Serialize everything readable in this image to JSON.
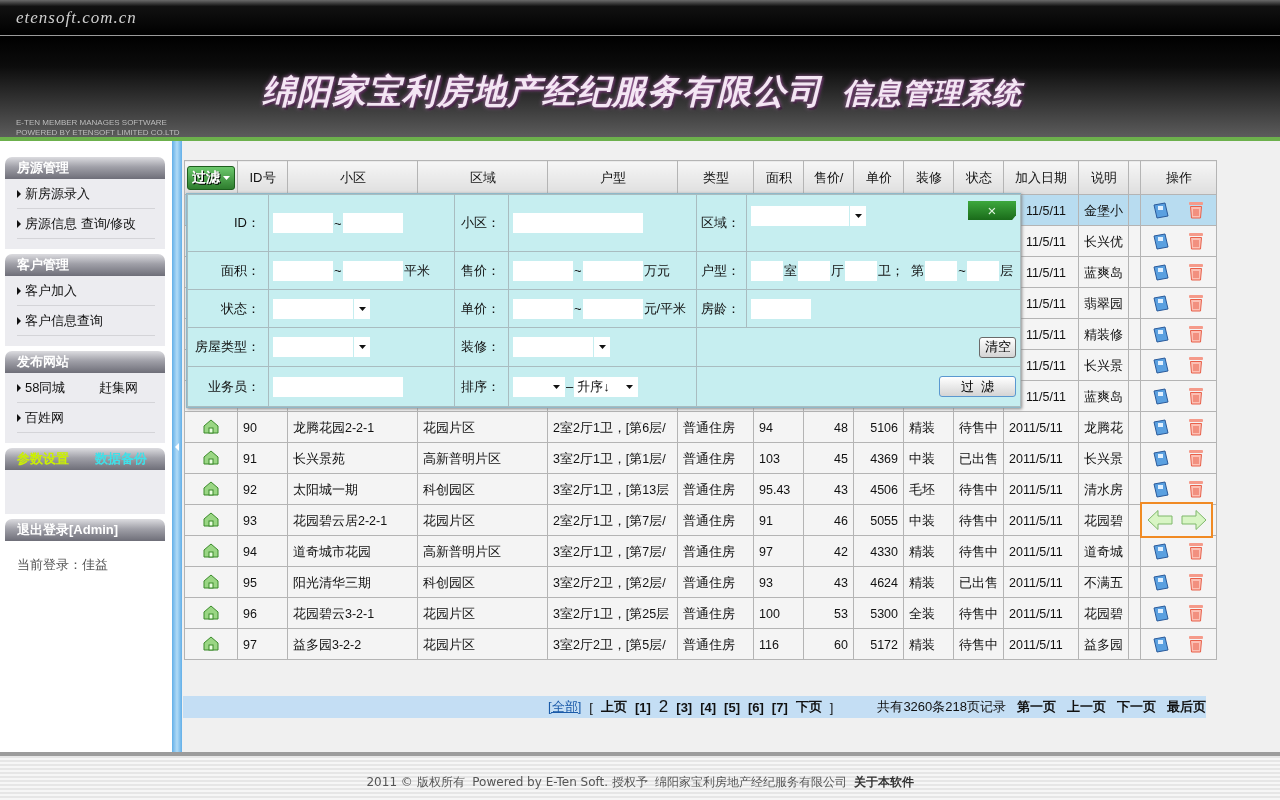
{
  "header": {
    "site": "etensoft.com.cn",
    "title": "绵阳家宝利房地产经纪服务有限公司",
    "subtitle": "信息管理系统",
    "tagline_lines": [
      "E-TEN MEMBER MANAGES SOFTWARE",
      "POWERED BY ETENSOFT LIMITED CO.LTD"
    ]
  },
  "sidebar": {
    "sections": [
      {
        "kind": "menu",
        "title": "房源管理",
        "items": [
          {
            "links": [
              "新房源录入"
            ]
          },
          {
            "links": [
              "房源信息 查询/修改"
            ]
          }
        ]
      },
      {
        "kind": "menu",
        "title": "客户管理",
        "items": [
          {
            "links": [
              "客户加入"
            ]
          },
          {
            "links": [
              "客户信息查询"
            ]
          }
        ]
      },
      {
        "kind": "menu",
        "title": "发布网站",
        "items": [
          {
            "links": [
              "58同城",
              "赶集网"
            ]
          },
          {
            "links": [
              "百姓网"
            ]
          }
        ]
      },
      {
        "kind": "links",
        "links": [
          {
            "text": "参数设置",
            "color": "#ccf000"
          },
          {
            "text": "数据备份",
            "color": "#40e0e8"
          }
        ]
      },
      {
        "kind": "plain",
        "title": "退出登录[Admin]"
      }
    ],
    "current_user": "当前登录：佳益"
  },
  "table": {
    "filter_button": "过滤",
    "columns": [
      "ID号",
      "小区",
      "区域",
      "户型",
      "类型",
      "面积",
      "售价/",
      "单价",
      "装修",
      "状态",
      "加入日期",
      "说明",
      "操作"
    ],
    "rows": [
      {
        "kind": "covered",
        "date": "11/5/11",
        "note": "金堡小",
        "selected": true,
        "hovered": false
      },
      {
        "kind": "covered",
        "date": "11/5/11",
        "note": "长兴优",
        "selected": false,
        "hovered": false
      },
      {
        "kind": "covered",
        "date": "11/5/11",
        "note": "蓝爽岛",
        "selected": false,
        "hovered": false
      },
      {
        "kind": "covered",
        "date": "11/5/11",
        "note": "翡翠园",
        "selected": false,
        "hovered": false
      },
      {
        "kind": "covered",
        "date": "11/5/11",
        "note": "精装修",
        "selected": false,
        "hovered": false
      },
      {
        "kind": "covered",
        "date": "11/5/11",
        "note": "长兴景",
        "selected": false,
        "hovered": false
      },
      {
        "kind": "covered",
        "date": "11/5/11",
        "note": "蓝爽岛",
        "selected": false,
        "hovered": false
      },
      {
        "kind": "full",
        "id": "90",
        "community": "龙腾花园2-2-1",
        "district": "花园片区",
        "layout": "2室2厅1卫，[第6层/",
        "type": "普通住房",
        "area": "94",
        "price": "48",
        "unit_price": "5106",
        "decoration": "精装",
        "status": "待售中",
        "date": "2011/5/11",
        "note": "龙腾花",
        "selected": false,
        "hovered": false
      },
      {
        "kind": "full",
        "id": "91",
        "community": "长兴景苑",
        "district": "高新普明片区",
        "layout": "3室2厅1卫，[第1层/",
        "type": "普通住房",
        "area": "103",
        "price": "45",
        "unit_price": "4369",
        "decoration": "中装",
        "status": "已出售",
        "date": "2011/5/11",
        "note": "长兴景",
        "selected": false,
        "hovered": false
      },
      {
        "kind": "full",
        "id": "92",
        "community": "太阳城一期",
        "district": "科创园区",
        "layout": "3室2厅1卫，[第13层",
        "type": "普通住房",
        "area": "95.43",
        "price": "43",
        "unit_price": "4506",
        "decoration": "毛坯",
        "status": "待售中",
        "date": "2011/5/11",
        "note": "清水房",
        "selected": false,
        "hovered": false
      },
      {
        "kind": "full",
        "id": "93",
        "community": "花园碧云居2-2-1",
        "district": "花园片区",
        "layout": "2室2厅1卫，[第7层/",
        "type": "普通住房",
        "area": "91",
        "price": "46",
        "unit_price": "5055",
        "decoration": "中装",
        "status": "待售中",
        "date": "2011/5/11",
        "note": "花园碧",
        "selected": false,
        "hovered": true
      },
      {
        "kind": "full",
        "id": "94",
        "community": "道奇城市花园",
        "district": "高新普明片区",
        "layout": "3室2厅1卫，[第7层/",
        "type": "普通住房",
        "area": "97",
        "price": "42",
        "unit_price": "4330",
        "decoration": "精装",
        "status": "待售中",
        "date": "2011/5/11",
        "note": "道奇城",
        "selected": false,
        "hovered": false
      },
      {
        "kind": "full",
        "id": "95",
        "community": "阳光清华三期",
        "district": "科创园区",
        "layout": "3室2厅2卫，[第2层/",
        "type": "普通住房",
        "area": "93",
        "price": "43",
        "unit_price": "4624",
        "decoration": "精装",
        "status": "已出售",
        "date": "2011/5/11",
        "note": "不满五",
        "selected": false,
        "hovered": false
      },
      {
        "kind": "full",
        "id": "96",
        "community": "花园碧云3-2-1",
        "district": "花园片区",
        "layout": "3室2厅1卫，[第25层",
        "type": "普通住房",
        "area": "100",
        "price": "53",
        "unit_price": "5300",
        "decoration": "全装",
        "status": "待售中",
        "date": "2011/5/11",
        "note": "花园碧",
        "selected": false,
        "hovered": false
      },
      {
        "kind": "full",
        "id": "97",
        "community": "益多园3-2-2",
        "district": "花园片区",
        "layout": "3室2厅2卫，[第5层/",
        "type": "普通住房",
        "area": "116",
        "price": "60",
        "unit_price": "5172",
        "decoration": "精装",
        "status": "待售中",
        "date": "2011/5/11",
        "note": "益多园",
        "selected": false,
        "hovered": false
      }
    ]
  },
  "filter_panel": {
    "rows": [
      {
        "cells": [
          {
            "label": "ID：",
            "parts": [
              {
                "kind": "input"
              },
              {
                "kind": "text",
                "text": "~"
              },
              {
                "kind": "input"
              }
            ]
          },
          {
            "label": "小区：",
            "parts": [
              {
                "kind": "input-long"
              }
            ]
          },
          {
            "label": "区域：",
            "parts": [
              {
                "kind": "select-long"
              }
            ],
            "button": {
              "kind": "close",
              "text": "×"
            }
          }
        ]
      },
      {
        "cells": [
          {
            "label": "面积：",
            "parts": [
              {
                "kind": "input"
              },
              {
                "kind": "text",
                "text": "~"
              },
              {
                "kind": "input"
              },
              {
                "kind": "text",
                "text": "平米"
              }
            ]
          },
          {
            "label": "售价：",
            "parts": [
              {
                "kind": "input"
              },
              {
                "kind": "text",
                "text": "~"
              },
              {
                "kind": "input"
              },
              {
                "kind": "text",
                "text": "万元"
              }
            ]
          },
          {
            "label": "户型：",
            "parts": [
              {
                "kind": "input-tiny"
              },
              {
                "kind": "text",
                "text": "室"
              },
              {
                "kind": "input-tiny"
              },
              {
                "kind": "text",
                "text": "厅"
              },
              {
                "kind": "input-tiny"
              },
              {
                "kind": "text",
                "text": "卫；  第"
              },
              {
                "kind": "input-tiny"
              },
              {
                "kind": "text",
                "text": "~"
              },
              {
                "kind": "input-tiny"
              },
              {
                "kind": "text",
                "text": "层"
              }
            ]
          }
        ]
      },
      {
        "cells": [
          {
            "label": "状态：",
            "parts": [
              {
                "kind": "select"
              }
            ]
          },
          {
            "label": "单价：",
            "parts": [
              {
                "kind": "input"
              },
              {
                "kind": "text",
                "text": "~"
              },
              {
                "kind": "input"
              },
              {
                "kind": "text",
                "text": "元/平米"
              }
            ]
          },
          {
            "label": "房龄：",
            "parts": [
              {
                "kind": "input"
              }
            ]
          }
        ]
      },
      {
        "cells": [
          {
            "label": "房屋类型：",
            "parts": [
              {
                "kind": "select"
              }
            ]
          },
          {
            "label": "装修：",
            "parts": [
              {
                "kind": "select"
              }
            ]
          },
          {
            "button": {
              "kind": "plain",
              "text": "清空"
            }
          }
        ]
      },
      {
        "cells": [
          {
            "label": "业务员：",
            "parts": [
              {
                "kind": "input-long"
              }
            ]
          },
          {
            "label": "排序：",
            "parts": [
              {
                "kind": "select-short"
              },
              {
                "kind": "text",
                "text": "–"
              },
              {
                "kind": "select-mid",
                "value": "升序↓"
              }
            ]
          },
          {
            "button": {
              "kind": "submit",
              "text": "过  滤"
            }
          }
        ]
      }
    ]
  },
  "pager": {
    "items": [
      {
        "kind": "all",
        "text": "[全部]"
      },
      {
        "kind": "bracket",
        "text": "["
      },
      {
        "kind": "nav",
        "text": "上页"
      },
      {
        "kind": "page",
        "text": "[1]",
        "selected": false
      },
      {
        "kind": "page",
        "text": "2",
        "selected": true
      },
      {
        "kind": "page",
        "text": "[3]",
        "selected": false
      },
      {
        "kind": "page",
        "text": "[4]",
        "selected": false
      },
      {
        "kind": "page",
        "text": "[5]",
        "selected": false
      },
      {
        "kind": "page",
        "text": "[6]",
        "selected": false
      },
      {
        "kind": "page",
        "text": "[7]",
        "selected": false
      },
      {
        "kind": "nav",
        "text": "下页"
      },
      {
        "kind": "bracket",
        "text": "]"
      }
    ],
    "summary": "共有3260条218页记录",
    "nav": [
      "第一页",
      "上一页",
      "下一页",
      "最后页"
    ]
  },
  "footer": {
    "text": "2011 © 版权所有  Powered by E-Ten Soft. 授权予  绵阳家宝利房地产经纪服务有限公司",
    "link": "关于本软件"
  }
}
